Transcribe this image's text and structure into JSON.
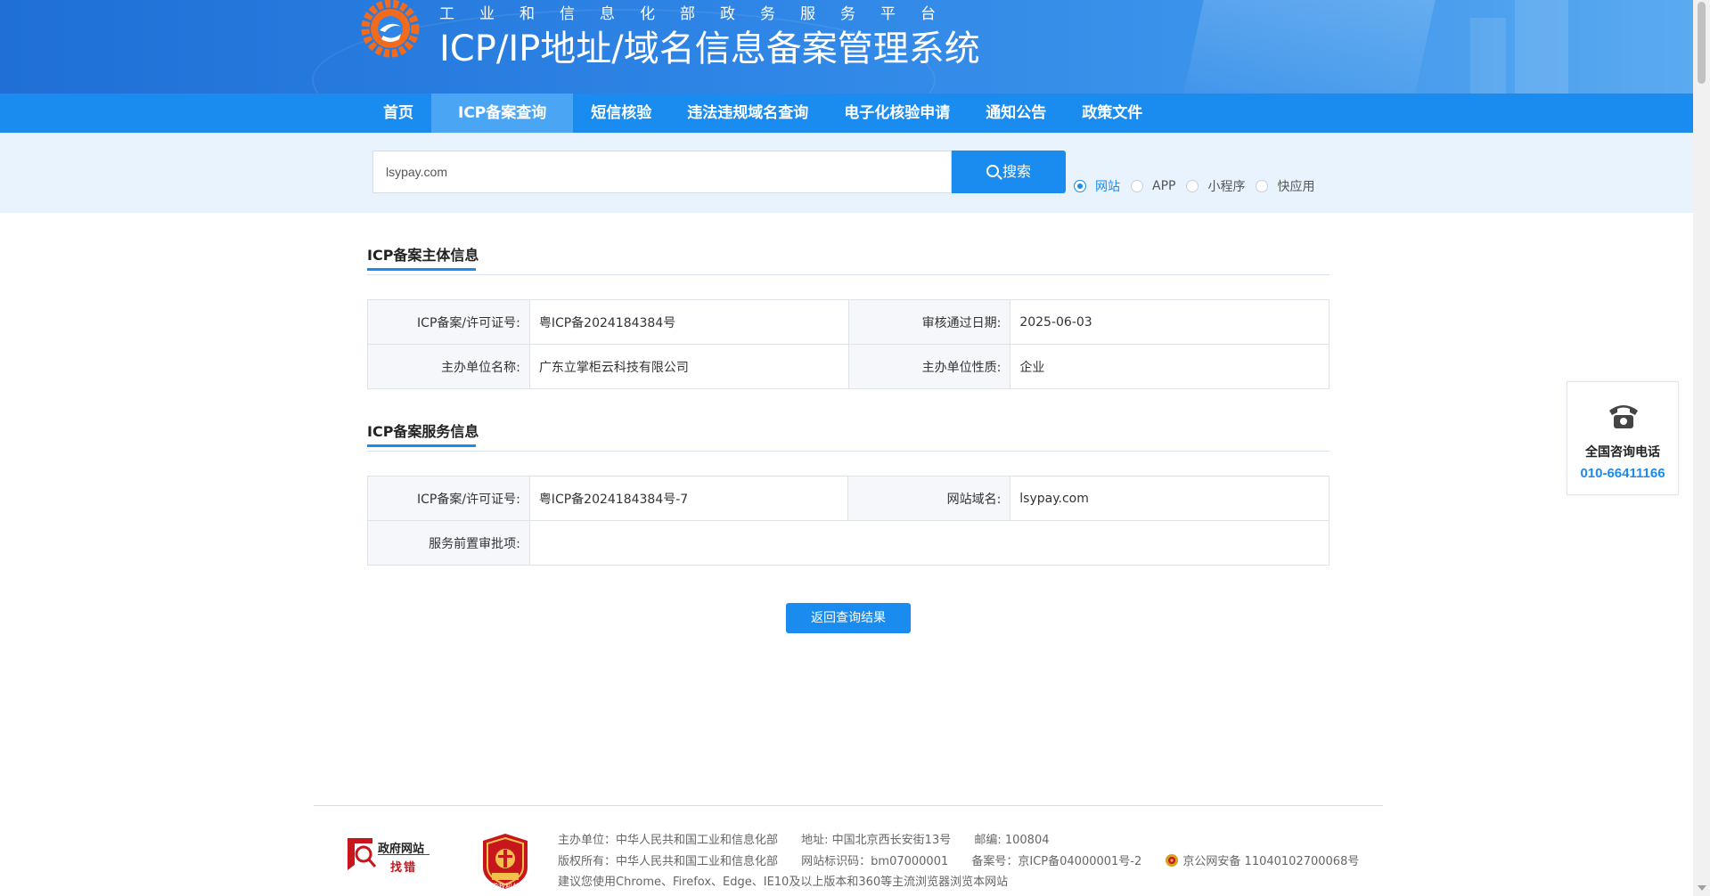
{
  "header": {
    "subtitle": "工业和信息化部政务服务平台",
    "title": "ICP/IP地址/域名信息备案管理系统"
  },
  "nav": {
    "items": [
      {
        "label": "首页"
      },
      {
        "label": "ICP备案查询"
      },
      {
        "label": "短信核验"
      },
      {
        "label": "违法违规域名查询"
      },
      {
        "label": "电子化核验申请"
      },
      {
        "label": "通知公告"
      },
      {
        "label": "政策文件"
      }
    ],
    "active_index": 1
  },
  "search": {
    "value": "lsypay.com",
    "button_label": "搜索",
    "types": [
      {
        "label": "网站",
        "checked": true
      },
      {
        "label": "APP",
        "checked": false
      },
      {
        "label": "小程序",
        "checked": false
      },
      {
        "label": "快应用",
        "checked": false
      }
    ]
  },
  "subject_info": {
    "title": "ICP备案主体信息",
    "license_label": "ICP备案/许可证号:",
    "license_value": "粤ICP备2024184384号",
    "approval_date_label": "审核通过日期:",
    "approval_date_value": "2025-06-03",
    "org_name_label": "主办单位名称:",
    "org_name_value": "广东立掌柜云科技有限公司",
    "org_type_label": "主办单位性质:",
    "org_type_value": "企业"
  },
  "service_info": {
    "title": "ICP备案服务信息",
    "license_label": "ICP备案/许可证号:",
    "license_value": "粤ICP备2024184384号-7",
    "domain_label": "网站域名:",
    "domain_value": "lsypay.com",
    "pre_approval_label": "服务前置审批项:",
    "pre_approval_value": ""
  },
  "back_button": "返回查询结果",
  "hotline": {
    "label": "全国咨询电话",
    "number": "010-66411166"
  },
  "footer": {
    "zfwz_line1": "政府网站",
    "zfwz_line2": "找错",
    "dzjg_label": "党政机关",
    "line1": [
      "主办单位：中华人民共和国工业和信息化部",
      "地址: 中国北京西长安街13号",
      "邮编: 100804"
    ],
    "line2": [
      "版权所有：中华人民共和国工业和信息化部",
      "网站标识码：bm07000001",
      "备案号：京ICP备04000001号-2"
    ],
    "police": "京公网安备 11040102700068号",
    "line3": "建议您使用Chrome、Firefox、Edge、IE10及以上版本和360等主流浏览器浏览本网站"
  },
  "colors": {
    "brand": "#1a8cf0",
    "banner": "#2f86e6",
    "accent_red": "#c8161d"
  }
}
